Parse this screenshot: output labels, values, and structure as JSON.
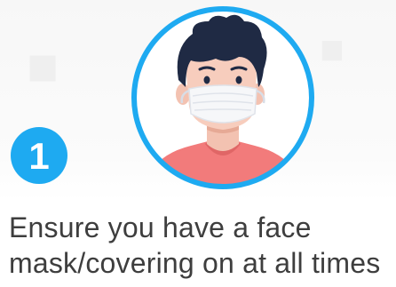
{
  "step": {
    "number": "1",
    "accent_color": "#1eaaf1"
  },
  "illustration": {
    "icon": "person-wearing-face-mask-icon",
    "ring_color": "#1eaaf1",
    "hair_color": "#1f2a44",
    "shirt_color": "#f27b7b",
    "mask_color": "#f6f7f9"
  },
  "caption": {
    "line1": "Ensure you have a face",
    "line2": "mask/covering on at all times"
  }
}
